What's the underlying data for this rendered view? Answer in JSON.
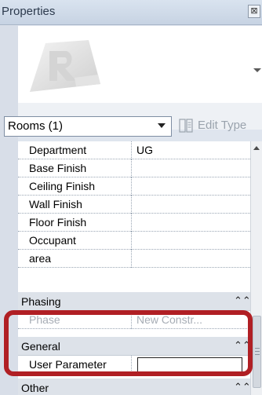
{
  "window": {
    "title": "Properties",
    "close_glyph": "⊠"
  },
  "type_selector": {
    "value": "Rooms (1)"
  },
  "edit_type": {
    "label": "Edit Type",
    "icon": "edit-type-icon"
  },
  "rows": [
    {
      "name": "Department",
      "value": "UG"
    },
    {
      "name": "Base Finish",
      "value": ""
    },
    {
      "name": "Ceiling Finish",
      "value": ""
    },
    {
      "name": "Wall Finish",
      "value": ""
    },
    {
      "name": "Floor Finish",
      "value": ""
    },
    {
      "name": "Occupant",
      "value": ""
    },
    {
      "name": "area",
      "value": ""
    }
  ],
  "groups": {
    "phasing": {
      "label": "Phasing",
      "chevron": "⌃⌃"
    },
    "general": {
      "label": "General",
      "chevron": "⌃⌃"
    },
    "other": {
      "label": "Other",
      "chevron": "⌃⌃"
    }
  },
  "phase_row": {
    "name": "Phase",
    "value": "New Constr..."
  },
  "user_parameter": {
    "name": "User Parameter",
    "value": ""
  },
  "colors": {
    "highlight": "#b01f24",
    "group_bg": "#dde2e9"
  }
}
